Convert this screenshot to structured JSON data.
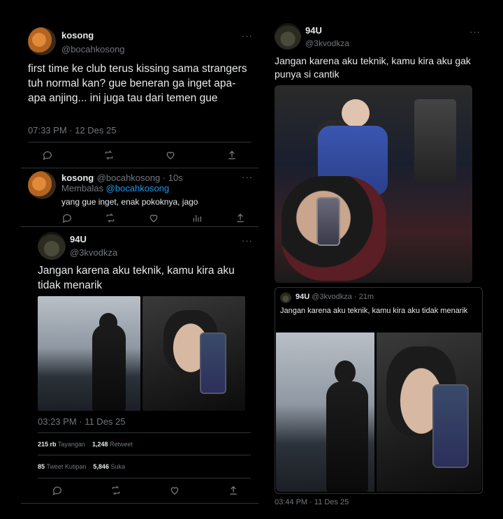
{
  "left": {
    "tweet1": {
      "name": "kosong",
      "handle": "@bocahkosong",
      "more": "···",
      "text": "first time ke club terus kissing sama strangers tuh normal kan? gue beneran ga inget apa-apa anjing... ini juga tau dari temen gue",
      "timestamp": "07:33 PM · 12 Des 25"
    },
    "reply": {
      "name": "kosong",
      "handle": "@bocahkosong · 10s",
      "more": "···",
      "replying_prefix": "Membalas",
      "replying_to": "@bocahkosong",
      "text": "yang gue inget, enak pokoknya, jago"
    },
    "tweet2": {
      "name": "94U",
      "handle": "@3kvodkza",
      "more": "···",
      "text": "Jangan karena aku teknik, kamu kira aku tidak menarik",
      "timestamp": "03:23 PM · 11 Des 25",
      "views_value": "215 rb",
      "views_label": "Tayangan",
      "retweets_value": "1,248",
      "retweets_label": "Retweet",
      "quotes_value": "85",
      "quotes_label": "Tweet Kutipan",
      "likes_value": "5,846",
      "likes_label": "Suka"
    }
  },
  "right": {
    "tweet": {
      "name": "94U",
      "handle": "@3kvodkza",
      "more": "···",
      "text": "Jangan karena aku teknik, kamu kira aku gak punya si cantik",
      "timestamp": "03:44 PM · 11 Des 25"
    },
    "quote": {
      "name": "94U",
      "handle": "@3kvodkza · 21m",
      "text": "Jangan karena aku teknik, kamu kira aku tidak menarik"
    }
  },
  "icons": [
    "reply-icon",
    "retweet-icon",
    "like-icon",
    "share-icon",
    "views-icon"
  ],
  "colors": {
    "background": "#000000",
    "text": "#e7e9ea",
    "muted": "#71767b",
    "link": "#1d9bf0",
    "divider": "#2f3336"
  }
}
